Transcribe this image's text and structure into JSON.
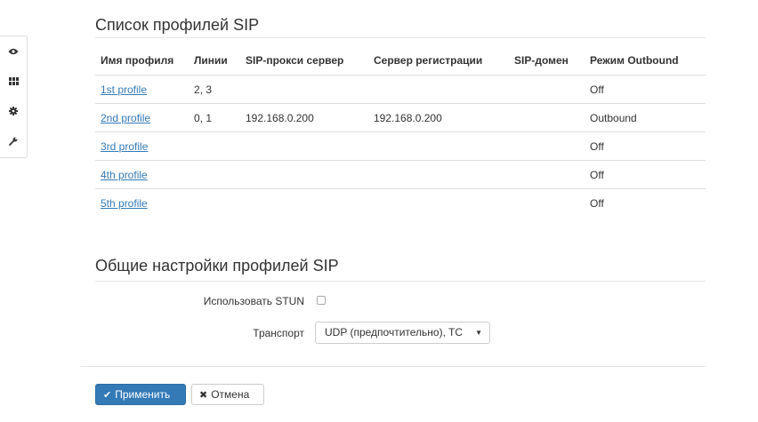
{
  "sidebar": {
    "items": [
      {
        "icon": "eye-icon",
        "name": "view"
      },
      {
        "icon": "grid-icon",
        "name": "apps"
      },
      {
        "icon": "gear-icon",
        "name": "settings"
      },
      {
        "icon": "wrench-icon",
        "name": "tools"
      }
    ]
  },
  "profiles_section": {
    "title": "Список профилей SIP",
    "columns": [
      "Имя профиля",
      "Линии",
      "SIP-прокси сервер",
      "Сервер регистрации",
      "SIP-домен",
      "Режим Outbound"
    ],
    "rows": [
      {
        "name": "1st profile",
        "lines": "2, 3",
        "proxy": "",
        "registrar": "",
        "domain": "",
        "outbound": "Off"
      },
      {
        "name": "2nd profile",
        "lines": "0, 1",
        "proxy": "192.168.0.200",
        "registrar": "192.168.0.200",
        "domain": "",
        "outbound": "Outbound"
      },
      {
        "name": "3rd profile",
        "lines": "",
        "proxy": "",
        "registrar": "",
        "domain": "",
        "outbound": "Off"
      },
      {
        "name": "4th profile",
        "lines": "",
        "proxy": "",
        "registrar": "",
        "domain": "",
        "outbound": "Off"
      },
      {
        "name": "5th profile",
        "lines": "",
        "proxy": "",
        "registrar": "",
        "domain": "",
        "outbound": "Off"
      }
    ]
  },
  "general_section": {
    "title": "Общие настройки профилей SIP",
    "stun_label": "Использовать STUN",
    "stun_checked": false,
    "transport_label": "Транспорт",
    "transport_value": "UDP (предпочтительно), TC"
  },
  "actions": {
    "apply_label": "Применить",
    "cancel_label": "Отмена"
  },
  "colors": {
    "primary": "#337ab7",
    "link": "#337ab7",
    "border": "#dddddd"
  }
}
